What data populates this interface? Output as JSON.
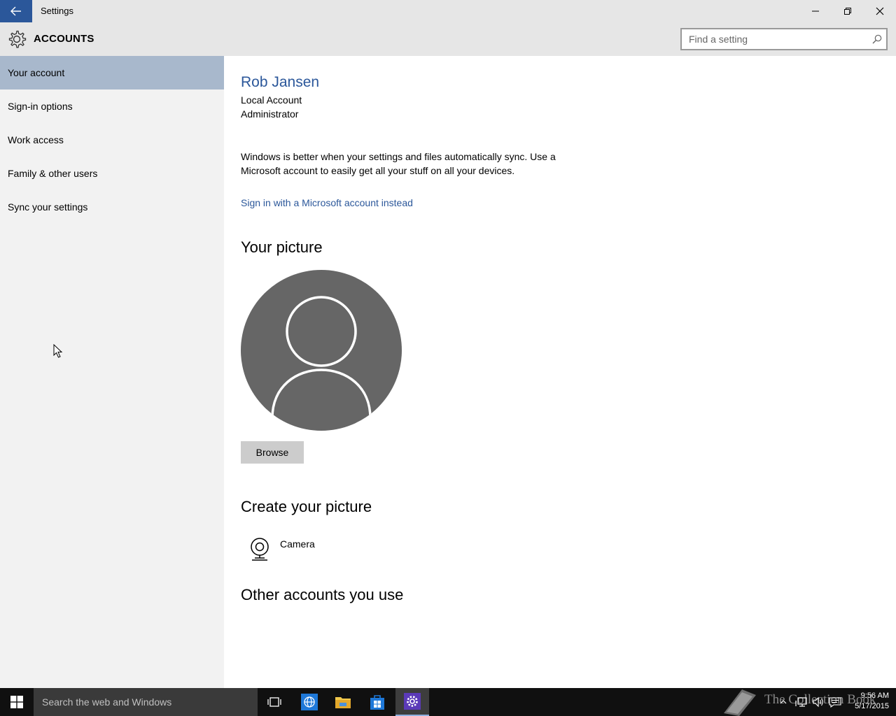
{
  "window": {
    "title": "Settings",
    "back_icon": "arrow-left-icon",
    "minimize_icon": "minimize-icon",
    "maximize_icon": "restore-icon",
    "close_icon": "close-icon"
  },
  "header": {
    "title": "ACCOUNTS",
    "icon": "gear-icon",
    "search_placeholder": "Find a setting",
    "search_value": ""
  },
  "sidebar": {
    "items": [
      {
        "label": "Your account",
        "active": true
      },
      {
        "label": "Sign-in options",
        "active": false
      },
      {
        "label": "Work access",
        "active": false
      },
      {
        "label": "Family & other users",
        "active": false
      },
      {
        "label": "Sync your settings",
        "active": false
      }
    ]
  },
  "account": {
    "name": "Rob Jansen",
    "type": "Local Account",
    "role": "Administrator",
    "sync_message": "Windows is better when your settings and files automatically sync. Use a Microsoft account to easily get all your stuff on all your devices.",
    "sign_in_link": "Sign in with a Microsoft account instead"
  },
  "picture": {
    "heading": "Your picture",
    "browse_label": "Browse"
  },
  "create_picture": {
    "heading": "Create your picture",
    "camera_label": "Camera"
  },
  "other_accounts": {
    "heading": "Other accounts you use"
  },
  "taskbar": {
    "search_placeholder": "Search the web and Windows",
    "watermark": "The Collection Book",
    "time": "9:56 AM",
    "date": "5/17/2015"
  },
  "colors": {
    "accent": "#2b579a",
    "active_nav": "#a8b8cc",
    "sidebar_bg": "#f2f2f2",
    "titlebar_bg": "#e6e6e6",
    "avatar_bg": "#666666",
    "taskbar_bg": "#101010"
  }
}
